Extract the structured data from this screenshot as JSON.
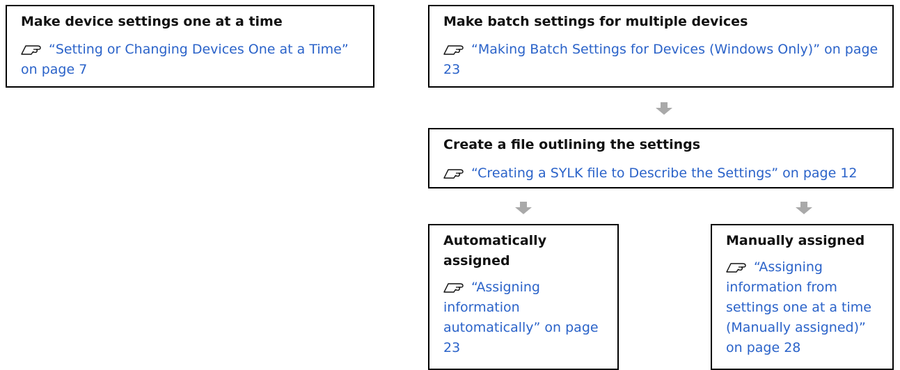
{
  "boxes": {
    "one_at_a_time": {
      "title": "Make device settings one at a time",
      "link": "“Setting or Changing Devices One at a Time” on page 7"
    },
    "batch": {
      "title": "Make batch settings for multiple devices",
      "link": "“Making Batch Settings for Devices (Windows Only)” on page 23"
    },
    "file": {
      "title": "Create a file outlining the settings",
      "link": "“Creating a SYLK file to Describe the Settings” on page 12"
    },
    "automatic": {
      "title": "Automatically assigned",
      "link": "“Assigning information automatically” on page 23"
    },
    "manual": {
      "title": "Manually assigned",
      "link": "“Assigning information from settings one at a time (Manually assigned)” on page 28"
    }
  },
  "colors": {
    "link": "#2b63c9",
    "border": "#000000",
    "arrow": "#a9a9a9"
  },
  "icons": {
    "reference": "pointing-hand-icon",
    "flow_arrow": "down-arrow-icon"
  }
}
